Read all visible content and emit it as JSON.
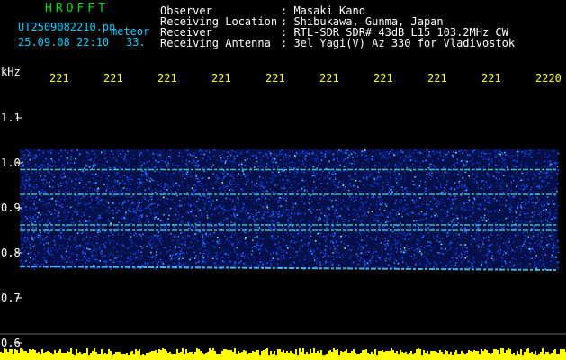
{
  "colors": {
    "brand": "#00dd00",
    "info_text": "#ffffff",
    "file_text": "#00d0ff",
    "x_tick": "#ffff00",
    "y_tick": "#ffffff",
    "background": "#000000",
    "baseline": "#ffff00"
  },
  "header": {
    "brand": "HROFFT",
    "file_name": "UT2509082210.pn",
    "mode": "meteor",
    "timestamp": "25.09.08 22:10",
    "counter": "33."
  },
  "info": [
    {
      "label": "Observer",
      "value": ": Masaki Kano"
    },
    {
      "label": "Receiving Location",
      "value": ": Shibukawa, Gunma, Japan"
    },
    {
      "label": "Receiver",
      "value": ": RTL-SDR SDR# 43dB L15 103.2MHz CW"
    },
    {
      "label": "Receiving Antenna",
      "value": ": 3el Yagi(V) Az 330 for Vladivostok"
    }
  ],
  "axis": {
    "y_unit": "kHz",
    "x_ticks": [
      "221",
      "221",
      "221",
      "221",
      "221",
      "221",
      "221",
      "221",
      "221",
      "2220"
    ],
    "y_ticks": [
      "1.1",
      "1.0",
      "0.9",
      "0.8",
      "0.7",
      "0.6"
    ]
  },
  "chart_data": {
    "type": "heatmap",
    "xlabel": "",
    "ylabel": "kHz",
    "x_ticks": [
      "221",
      "221",
      "221",
      "221",
      "221",
      "221",
      "221",
      "221",
      "221",
      "2220"
    ],
    "y_ticks": [
      1.1,
      1.0,
      0.9,
      0.8,
      0.7,
      0.6
    ],
    "ylim": [
      0.58,
      1.17
    ],
    "noise_band_khz": [
      0.765,
      1.03
    ],
    "carrier_lines_khz": [
      0.985,
      0.93,
      0.862,
      0.85,
      0.77
    ],
    "grid": false
  }
}
